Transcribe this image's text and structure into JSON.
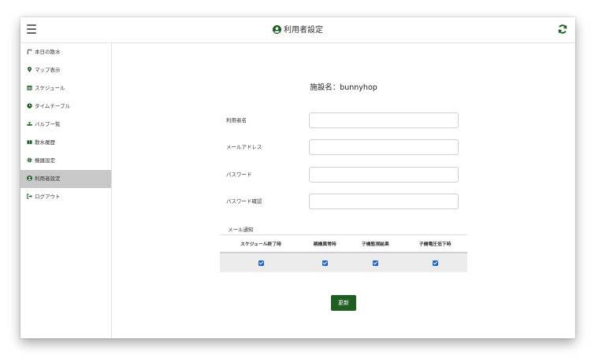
{
  "header": {
    "title": "利用者設定"
  },
  "sidebar": {
    "items": [
      {
        "label": "本日の散水",
        "icon": "sprinkler-icon"
      },
      {
        "label": "マップ表示",
        "icon": "map-marker-icon"
      },
      {
        "label": "スケジュール",
        "icon": "calendar-icon"
      },
      {
        "label": "タイムテーブル",
        "icon": "clock-icon"
      },
      {
        "label": "バルブ一覧",
        "icon": "valve-icon"
      },
      {
        "label": "散水履歴",
        "icon": "book-icon"
      },
      {
        "label": "機器設定",
        "icon": "gear-icon"
      },
      {
        "label": "利用者設定",
        "icon": "user-circle-icon",
        "active": true
      },
      {
        "label": "ログアウト",
        "icon": "logout-icon"
      }
    ]
  },
  "main": {
    "facility_label": "施設名：bunnyhop",
    "fields": {
      "username": {
        "label": "利用者名",
        "value": ""
      },
      "email": {
        "label": "メールアドレス",
        "value": ""
      },
      "password": {
        "label": "パスワード",
        "value": ""
      },
      "password_confirm": {
        "label": "パスワード確認",
        "value": ""
      }
    },
    "notification": {
      "label": "メール通知",
      "columns": [
        "スケジュール終了時",
        "親機異常時",
        "子機監視結果",
        "子機電圧低下時"
      ],
      "checked": [
        true,
        true,
        true,
        true
      ]
    },
    "update_label": "更新"
  },
  "colors": {
    "brand_green": "#1f5e23",
    "checkbox_blue": "#1a63d8",
    "active_item_bg": "#c8c8c8"
  }
}
